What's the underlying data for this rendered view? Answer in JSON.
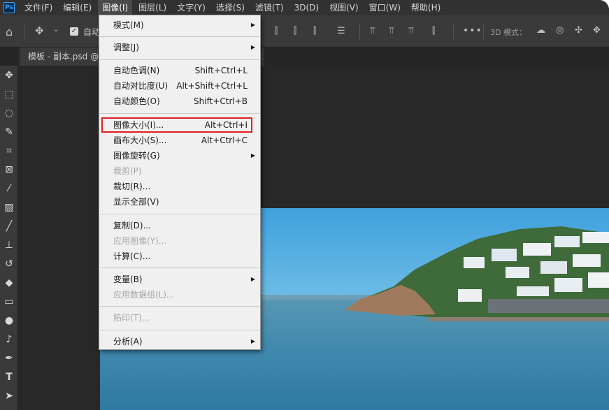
{
  "menubar": {
    "items": [
      {
        "label": "文件(F)"
      },
      {
        "label": "编辑(E)"
      },
      {
        "label": "图像(I)"
      },
      {
        "label": "图层(L)"
      },
      {
        "label": "文字(Y)"
      },
      {
        "label": "选择(S)"
      },
      {
        "label": "滤镜(T)"
      },
      {
        "label": "3D(D)"
      },
      {
        "label": "视图(V)"
      },
      {
        "label": "窗口(W)"
      },
      {
        "label": "帮助(H)"
      }
    ],
    "active_index": 2
  },
  "options": {
    "auto_select_label": "自动",
    "mode_3d_label": "3D 模式："
  },
  "document": {
    "tab_label": "模板 - 副本.psd @",
    "close_glyph": "×"
  },
  "tools": [
    "move-tool-icon",
    "marquee-tool-icon",
    "lasso-tool-icon",
    "quick-select-tool-icon",
    "crop-tool-icon",
    "frame-tool-icon",
    "eyedropper-tool-icon",
    "healing-brush-icon",
    "brush-tool-icon",
    "stamp-tool-icon",
    "history-brush-icon",
    "eraser-tool-icon",
    "gradient-tool-icon",
    "blur-tool-icon",
    "dodge-tool-icon",
    "pen-tool-icon",
    "type-tool-icon",
    "path-select-tool-icon"
  ],
  "image_menu": {
    "mode": {
      "label": "模式(M)"
    },
    "adjust": {
      "label": "调整(J)"
    },
    "auto_tone": {
      "label": "自动色调(N)",
      "shortcut": "Shift+Ctrl+L"
    },
    "auto_contrast": {
      "label": "自动对比度(U)",
      "shortcut": "Alt+Shift+Ctrl+L"
    },
    "auto_color": {
      "label": "自动颜色(O)",
      "shortcut": "Shift+Ctrl+B"
    },
    "image_size": {
      "label": "图像大小(I)...",
      "shortcut": "Alt+Ctrl+I"
    },
    "canvas_size": {
      "label": "画布大小(S)...",
      "shortcut": "Alt+Ctrl+C"
    },
    "image_rotation": {
      "label": "图像旋转(G)"
    },
    "crop": {
      "label": "裁剪(P)"
    },
    "trim": {
      "label": "裁切(R)..."
    },
    "reveal_all": {
      "label": "显示全部(V)"
    },
    "duplicate": {
      "label": "复制(D)..."
    },
    "apply_image": {
      "label": "应用图像(Y)..."
    },
    "calculations": {
      "label": "计算(C)..."
    },
    "variables": {
      "label": "变量(B)"
    },
    "apply_data_set": {
      "label": "应用数据组(L)..."
    },
    "trap": {
      "label": "陷印(T)..."
    },
    "analysis": {
      "label": "分析(A)"
    },
    "submenu_glyph": "▶"
  },
  "colors": {
    "highlight_border": "#e02020",
    "app_bg": "#282828",
    "menu_bg": "#f0f0f0"
  }
}
